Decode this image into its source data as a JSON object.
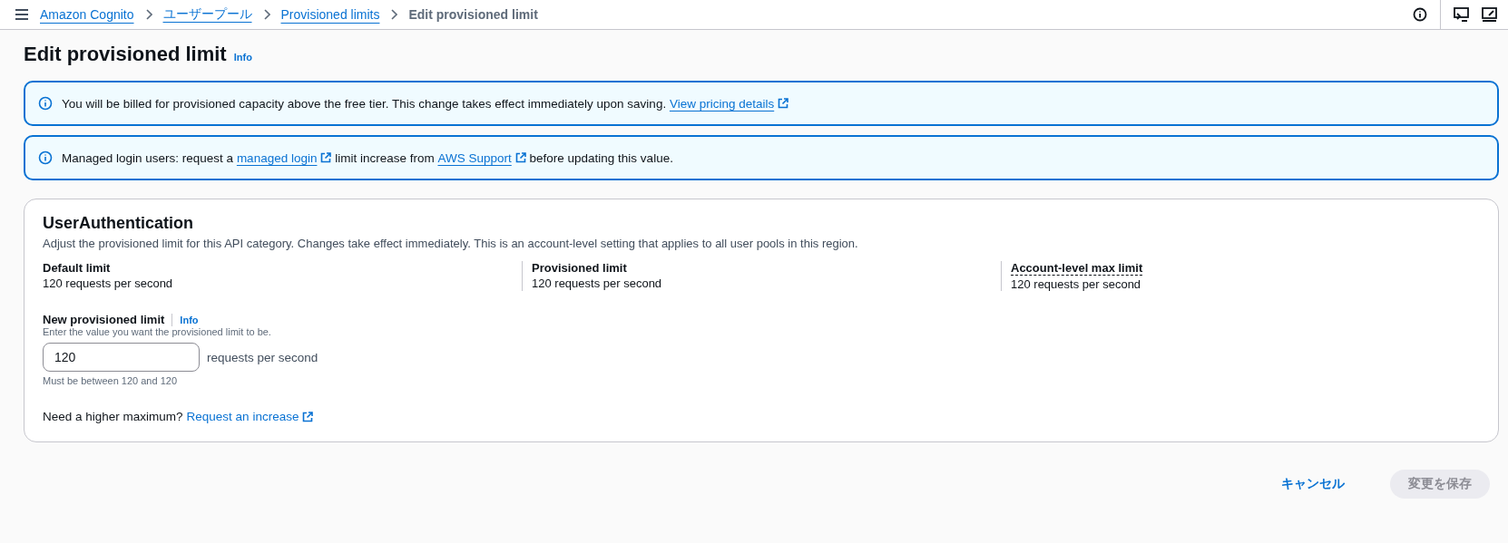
{
  "breadcrumbs": [
    {
      "label": "Amazon Cognito",
      "kind": "link"
    },
    {
      "label": "ユーザープール",
      "kind": "link"
    },
    {
      "label": "Provisioned limits",
      "kind": "link"
    },
    {
      "label": "Edit provisioned limit",
      "kind": "current"
    }
  ],
  "page_title": "Edit provisioned limit",
  "title_info": "Info",
  "alerts": [
    {
      "parts": [
        {
          "kind": "text",
          "text": "You will be billed for provisioned capacity above the free tier. This change takes effect immediately upon saving. "
        },
        {
          "kind": "link",
          "text": "View pricing details"
        }
      ]
    },
    {
      "parts": [
        {
          "kind": "text",
          "text": "Managed login users: request a "
        },
        {
          "kind": "link",
          "text": "managed login"
        },
        {
          "kind": "text",
          "text": " limit increase from "
        },
        {
          "kind": "link",
          "text": "AWS Support"
        },
        {
          "kind": "text",
          "text": " before updating this value."
        }
      ]
    }
  ],
  "card": {
    "title": "UserAuthentication",
    "description": "Adjust the provisioned limit for this API category. Changes take effect immediately. This is an account-level setting that applies to all user pools in this region.",
    "limits": [
      {
        "label": "Default limit",
        "value": "120 requests per second",
        "kind": "plain"
      },
      {
        "label": "Provisioned limit",
        "value": "120 requests per second",
        "kind": "plain"
      },
      {
        "label": "Account-level max limit",
        "value": "120 requests per second",
        "kind": "tooltip"
      }
    ],
    "field": {
      "label": "New provisioned limit",
      "info": "Info",
      "description": "Enter the value you want the provisioned limit to be.",
      "value": "120",
      "unit": "requests per second",
      "constraint": "Must be between 120 and 120"
    },
    "footer_text": "Need a higher maximum?",
    "footer_link": "Request an increase"
  },
  "actions": [
    {
      "label": "キャンセル",
      "kind": "link",
      "disabled": false
    },
    {
      "label": "変更を保存",
      "kind": "primary",
      "disabled": true
    }
  ]
}
